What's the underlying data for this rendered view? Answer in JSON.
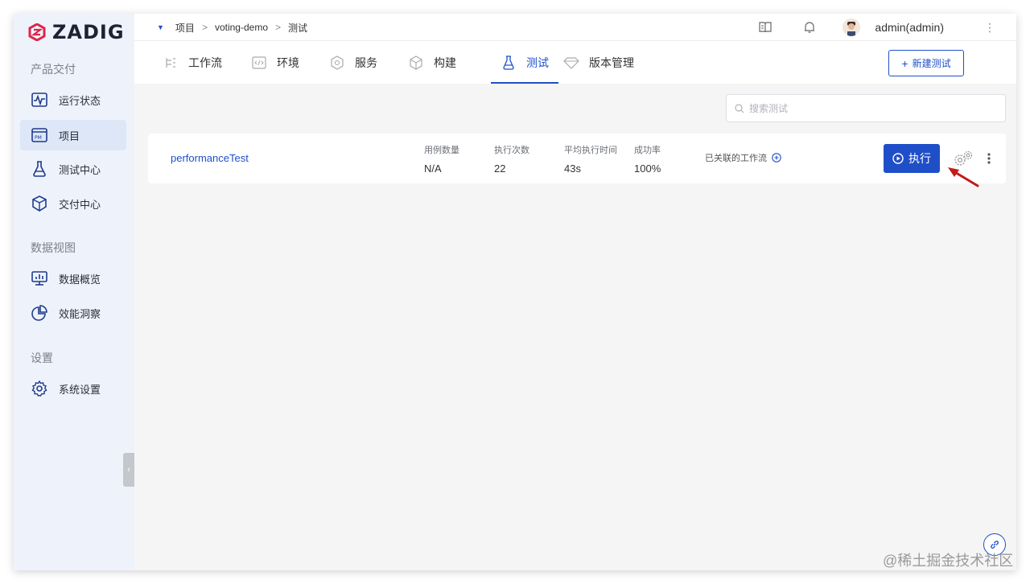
{
  "brand": {
    "name": "ZADIG",
    "color": "#e0244a"
  },
  "accent": "#1f4fc8",
  "sidebar": {
    "groups": [
      {
        "title": "产品交付",
        "items": [
          {
            "label": "运行状态",
            "icon": "pulse-icon",
            "active": false
          },
          {
            "label": "项目",
            "icon": "project-icon",
            "active": true
          },
          {
            "label": "测试中心",
            "icon": "flask-icon",
            "active": false
          },
          {
            "label": "交付中心",
            "icon": "package-icon",
            "active": false
          }
        ]
      },
      {
        "title": "数据视图",
        "items": [
          {
            "label": "数据概览",
            "icon": "monitor-chart-icon",
            "active": false
          },
          {
            "label": "效能洞察",
            "icon": "pie-chart-icon",
            "active": false
          }
        ]
      },
      {
        "title": "设置",
        "items": [
          {
            "label": "系统设置",
            "icon": "gear-icon",
            "active": false
          }
        ]
      }
    ]
  },
  "breadcrumb": [
    "项目",
    "voting-demo",
    "测试"
  ],
  "breadcrumb_separator": ">",
  "user": {
    "name": "admin(admin)"
  },
  "tabs": [
    {
      "label": "工作流",
      "icon": "workflow-icon",
      "active": false
    },
    {
      "label": "环境",
      "icon": "code-icon",
      "active": false
    },
    {
      "label": "服务",
      "icon": "service-icon",
      "active": false
    },
    {
      "label": "构建",
      "icon": "cube-icon",
      "active": false
    },
    {
      "label": "测试",
      "icon": "flask-icon",
      "active": true
    },
    {
      "label": "版本管理",
      "icon": "diamond-icon",
      "active": false
    }
  ],
  "new_test_button": {
    "label": "新建测试",
    "icon": "plus-icon"
  },
  "search": {
    "placeholder": "搜索测试",
    "value": ""
  },
  "tests": [
    {
      "name": "performanceTest",
      "stats": [
        {
          "label": "用例数量",
          "value": "N/A"
        },
        {
          "label": "执行次数",
          "value": "22"
        },
        {
          "label": "平均执行时间",
          "value": "43s"
        },
        {
          "label": "成功率",
          "value": "100%"
        }
      ],
      "linked_workflows_label": "已关联的工作流",
      "run_button_label": "执行"
    }
  ],
  "watermark": "@稀土掘金技术社区"
}
